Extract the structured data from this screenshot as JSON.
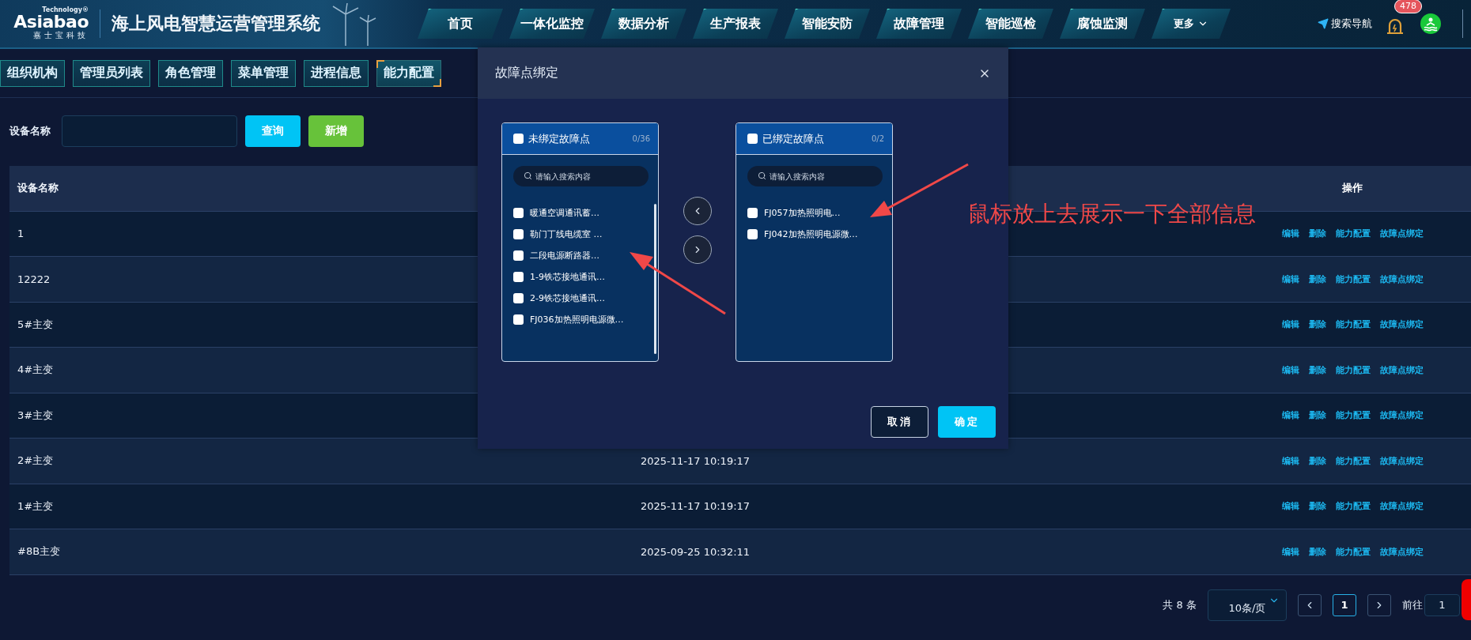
{
  "header": {
    "logo": {
      "tagline": "Technology®",
      "wordmark": "Asiabao",
      "subtitle": "嘉士宝科技"
    },
    "title": "海上风电智慧运营管理系统",
    "nav": [
      {
        "label": "首页",
        "kind": "link"
      },
      {
        "label": "一体化监控",
        "kind": "link"
      },
      {
        "label": "数据分析",
        "kind": "link"
      },
      {
        "label": "生产报表",
        "kind": "link"
      },
      {
        "label": "智能安防",
        "kind": "link"
      },
      {
        "label": "故障管理",
        "kind": "link"
      },
      {
        "label": "智能巡检",
        "kind": "link"
      },
      {
        "label": "腐蚀监测",
        "kind": "link"
      },
      {
        "label": "更多",
        "kind": "dropdown"
      }
    ],
    "search_nav": "搜索导航",
    "alarm_badge": "478"
  },
  "tabs": [
    {
      "label": "组织机构",
      "selected": false
    },
    {
      "label": "管理员列表",
      "selected": false
    },
    {
      "label": "角色管理",
      "selected": false
    },
    {
      "label": "菜单管理",
      "selected": false
    },
    {
      "label": "进程信息",
      "selected": false
    },
    {
      "label": "能力配置",
      "selected": true
    }
  ],
  "filter": {
    "label": "设备名称",
    "buttons": [
      {
        "label": "查询",
        "kind": "primary"
      },
      {
        "label": "新增",
        "kind": "success"
      }
    ]
  },
  "table": {
    "columns": [
      {
        "label": "设备名称"
      },
      {
        "label": "操作"
      }
    ],
    "rows": [
      {
        "name": "1",
        "actions": [
          "编辑",
          "删除",
          "能力配置",
          "故障点绑定"
        ]
      },
      {
        "name": "12222",
        "actions": [
          "编辑",
          "删除",
          "能力配置",
          "故障点绑定"
        ]
      },
      {
        "name": "5#主变",
        "actions": [
          "编辑",
          "删除",
          "能力配置",
          "故障点绑定"
        ]
      },
      {
        "name": "4#主变",
        "actions": [
          "编辑",
          "删除",
          "能力配置",
          "故障点绑定"
        ]
      },
      {
        "name": "3#主变",
        "actions": [
          "编辑",
          "删除",
          "能力配置",
          "故障点绑定"
        ]
      },
      {
        "name": "2#主变",
        "time": "2025-11-17 10:19:17",
        "actions": [
          "编辑",
          "删除",
          "能力配置",
          "故障点绑定"
        ]
      },
      {
        "name": "1#主变",
        "time": "2025-11-17 10:19:17",
        "actions": [
          "编辑",
          "删除",
          "能力配置",
          "故障点绑定"
        ]
      },
      {
        "name": "#8B主变",
        "time": "2025-09-25 10:32:11",
        "actions": [
          "编辑",
          "删除",
          "能力配置",
          "故障点绑定"
        ]
      }
    ]
  },
  "pagination": {
    "total": "共 8 条",
    "page_size": "10条/页",
    "pages": [
      {
        "label": "1",
        "selected": true
      }
    ],
    "goto_label": "前往",
    "goto_value": "1"
  },
  "dialog": {
    "title": "故障点绑定",
    "panels": [
      {
        "title": "未绑定故障点",
        "checked": false,
        "count": "0/36",
        "search_placeholder": "请输入搜索内容",
        "items": [
          {
            "label": "暖通空调通讯蓄…",
            "checked": false
          },
          {
            "label": "勒门丁线电缆室 …",
            "checked": false
          },
          {
            "label": "二段电源断路器…",
            "checked": false
          },
          {
            "label": "1-9铁芯接地通讯…",
            "checked": false
          },
          {
            "label": "2-9铁芯接地通讯…",
            "checked": false
          },
          {
            "label": "FJ036加热照明电源微…",
            "checked": false
          }
        ]
      },
      {
        "title": "已绑定故障点",
        "checked": false,
        "count": "0/2",
        "search_placeholder": "请输入搜索内容",
        "items": [
          {
            "label": "FJ057加热照明电…",
            "checked": false
          },
          {
            "label": "FJ042加热照明电源微…",
            "checked": false
          }
        ]
      }
    ],
    "buttons": [
      {
        "label": "取消",
        "kind": "default"
      },
      {
        "label": "确定",
        "kind": "primary"
      }
    ]
  },
  "annotation": {
    "text": "鼠标放上去展示一下全部信息"
  }
}
